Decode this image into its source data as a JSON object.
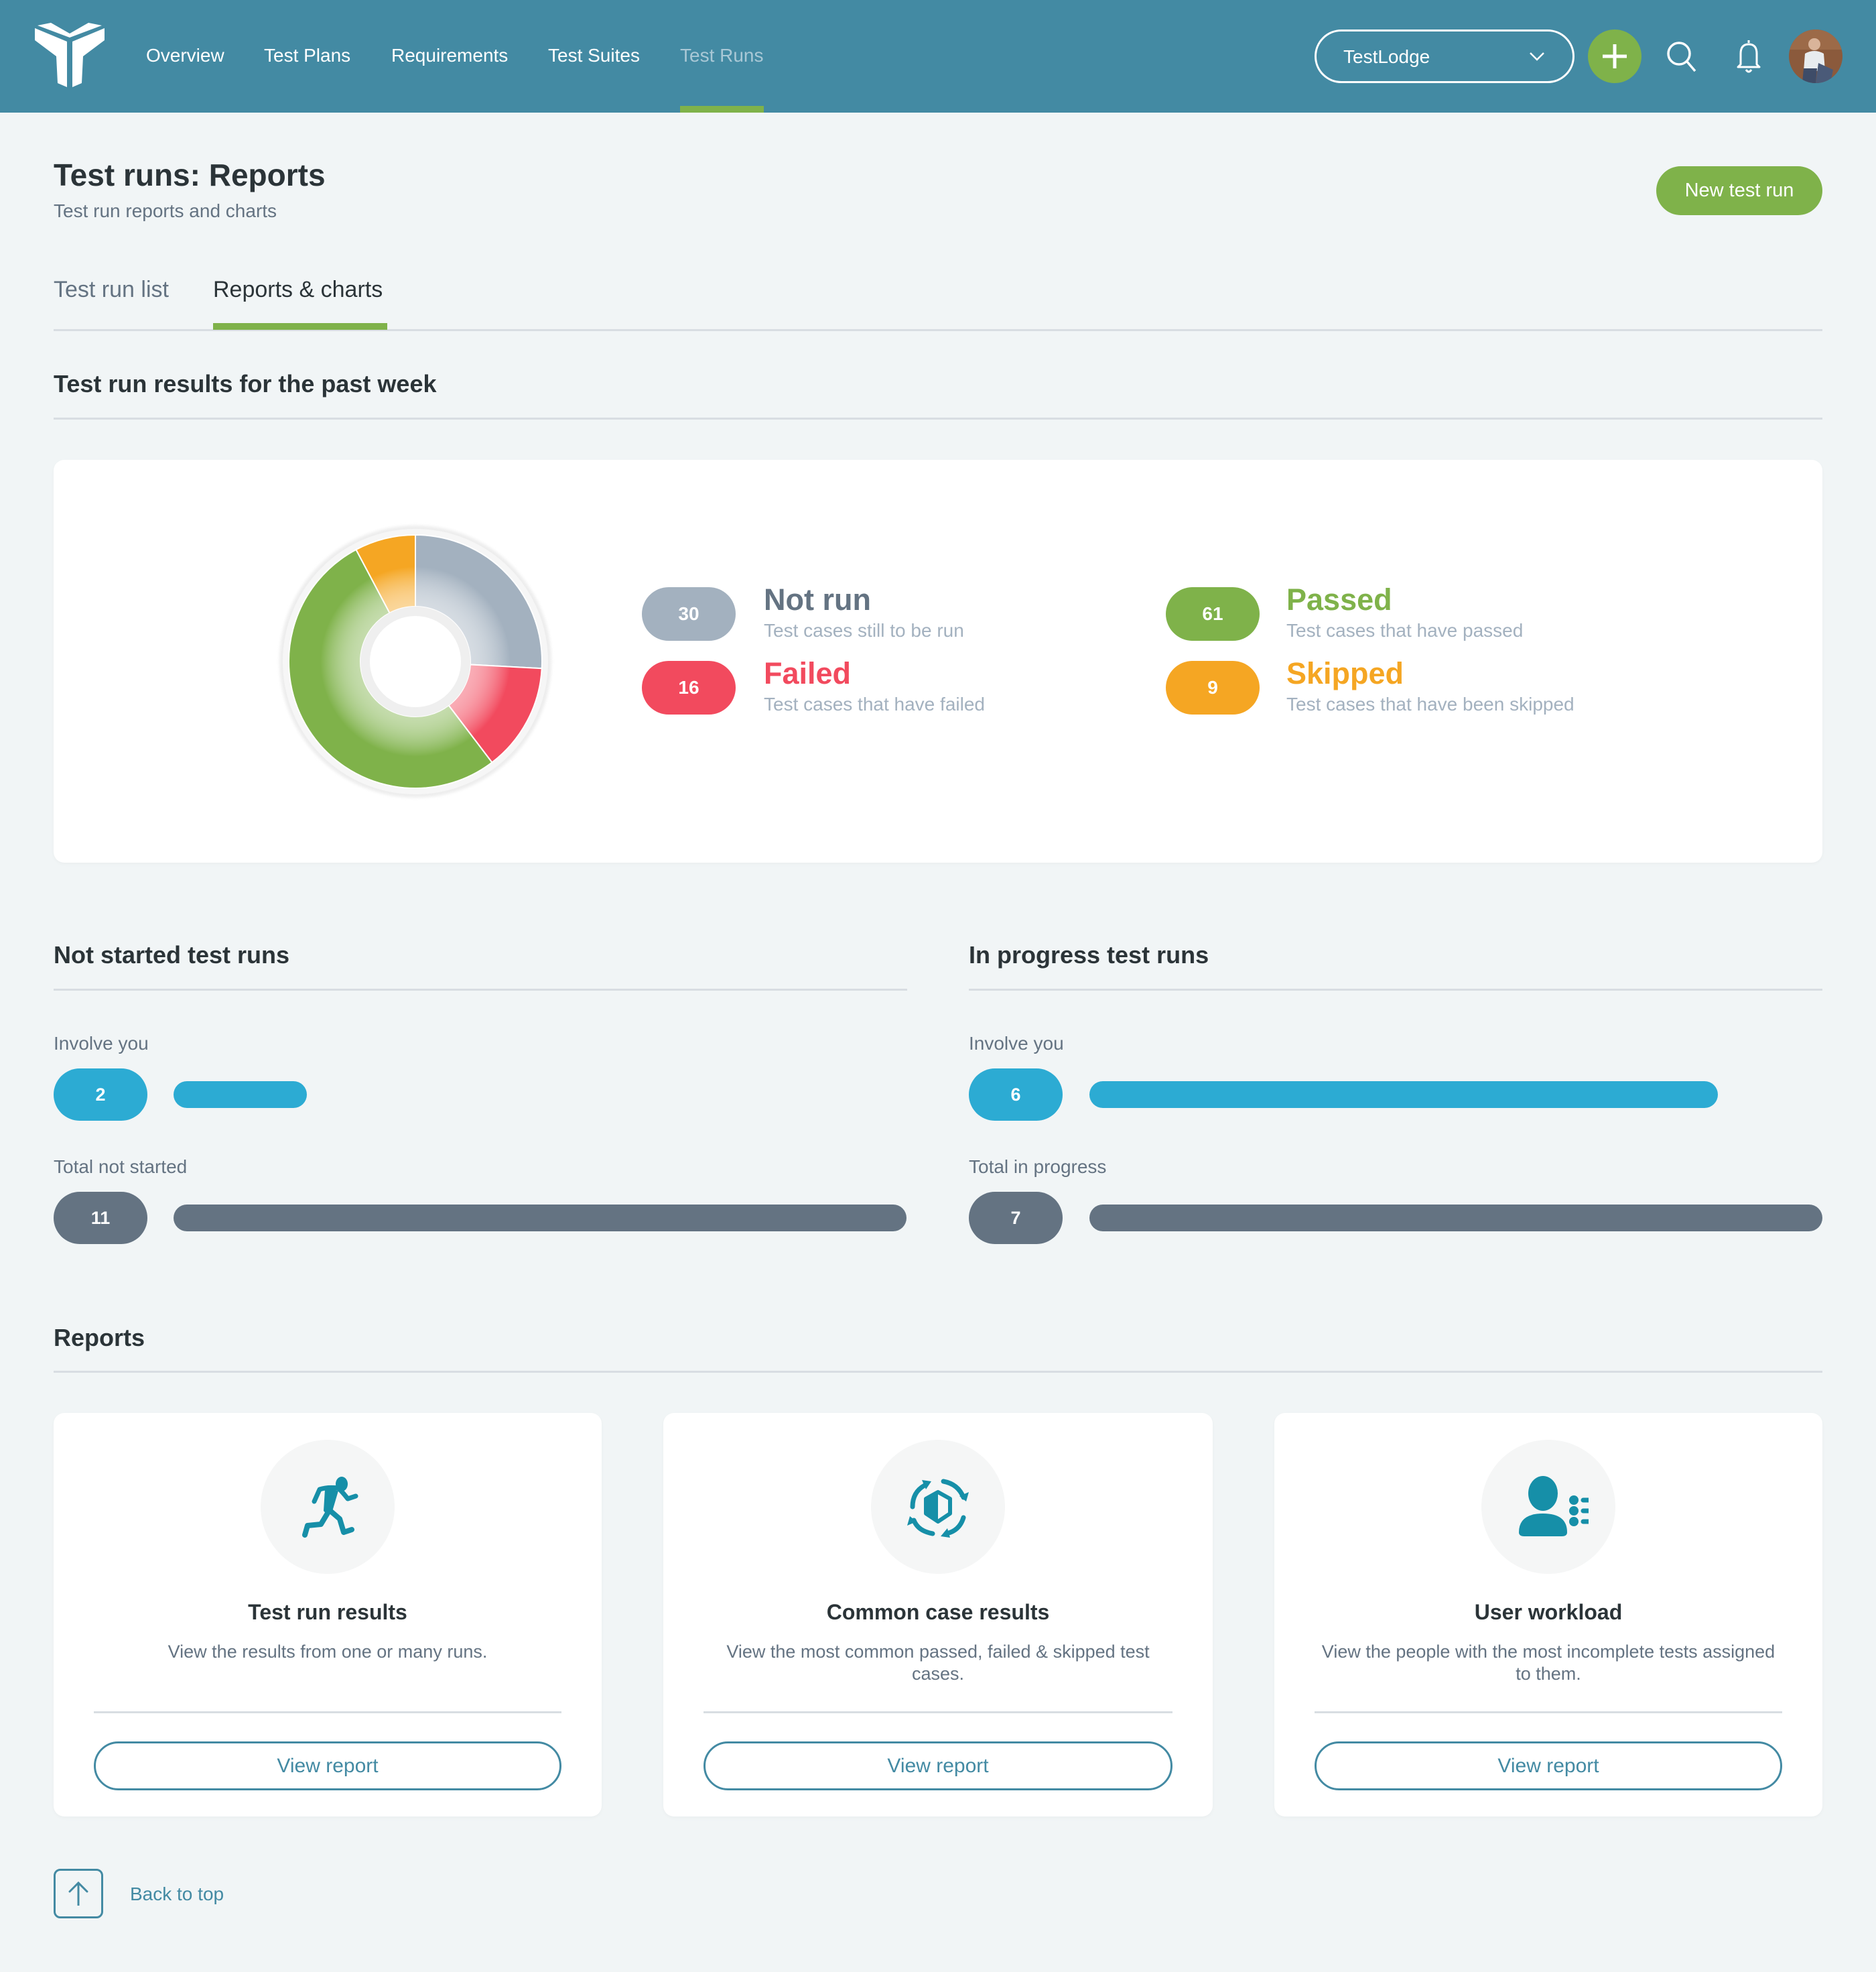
{
  "header": {
    "nav": [
      {
        "label": "Overview",
        "active": false
      },
      {
        "label": "Test Plans",
        "active": false
      },
      {
        "label": "Requirements",
        "active": false
      },
      {
        "label": "Test Suites",
        "active": false
      },
      {
        "label": "Test Runs",
        "active": true
      }
    ],
    "project_select": {
      "value": "TestLodge"
    },
    "icons": {
      "add": "plus-icon",
      "search": "search-icon",
      "notifications": "bell-icon",
      "avatar": "user-avatar"
    }
  },
  "page": {
    "title": "Test runs: Reports",
    "subtitle": "Test run reports and charts",
    "new_button": "New test run",
    "tabs": [
      {
        "label": "Test run list",
        "active": false
      },
      {
        "label": "Reports & charts",
        "active": true
      }
    ]
  },
  "results_section": {
    "title": "Test run results for the past week"
  },
  "chart_data": {
    "type": "pie",
    "variant": "donut",
    "title": "Test run results for the past week",
    "slices": [
      {
        "key": "not_run",
        "label": "Not run",
        "value": 30,
        "description": "Test cases still to be run",
        "color": "#A3B1BF",
        "title_color": "#647382"
      },
      {
        "key": "failed",
        "label": "Failed",
        "value": 16,
        "description": "Test cases that have failed",
        "color": "#F24A5E",
        "title_color": "#F24A5E"
      },
      {
        "key": "passed",
        "label": "Passed",
        "value": 61,
        "description": "Test cases that have passed",
        "color": "#7FB24A",
        "title_color": "#7FB24A"
      },
      {
        "key": "skipped",
        "label": "Skipped",
        "value": 9,
        "description": "Test cases that have been skipped",
        "color": "#F5A623",
        "title_color": "#F5A623"
      }
    ],
    "legend_placement": "right"
  },
  "not_started": {
    "title": "Not started test runs",
    "involve_label": "Involve you",
    "involve_value": 2,
    "total_label": "Total not started",
    "total_value": 11
  },
  "in_progress": {
    "title": "In progress test runs",
    "involve_label": "Involve you",
    "involve_value": 6,
    "total_label": "Total in progress",
    "total_value": 7
  },
  "colors": {
    "involve": "#2CABD3",
    "total": "#647382",
    "accent": "#7FB24A",
    "brand": "#438AA3",
    "icon": "#168FA8"
  },
  "reports": {
    "title": "Reports",
    "cards": [
      {
        "title": "Test run results",
        "description": "View the results from one or many runs.",
        "button": "View report",
        "icon": "running-person-icon"
      },
      {
        "title": "Common case results",
        "description": "View the most common passed, failed & skipped test cases.",
        "button": "View report",
        "icon": "cycle-cube-icon"
      },
      {
        "title": "User workload",
        "description": "View the people with the most incomplete tests assigned to them.",
        "button": "View report",
        "icon": "user-list-icon"
      }
    ]
  },
  "footer": {
    "back_to_top": "Back to top"
  }
}
